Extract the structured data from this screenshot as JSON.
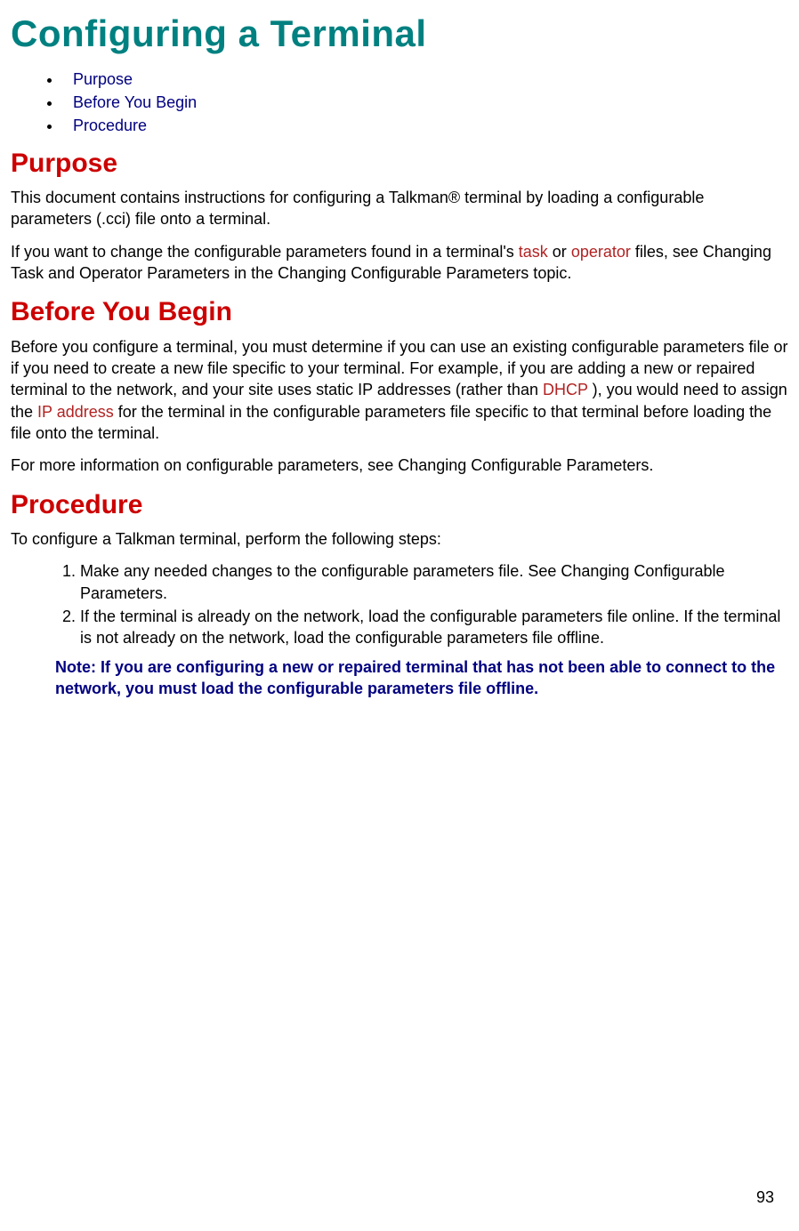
{
  "title": "Configuring a Terminal",
  "toc": {
    "items": [
      {
        "label": "Purpose"
      },
      {
        "label": "Before You Begin"
      },
      {
        "label": "Procedure"
      }
    ]
  },
  "purpose": {
    "heading": "Purpose",
    "p1": "This document contains instructions for configuring a Talkman® terminal by loading a configurable parameters (.cci) file onto a terminal.",
    "p2a": "If you want to change the configurable parameters found in a terminal's ",
    "link_task": "task",
    "p2b": " or ",
    "link_operator": "operator",
    "p2c": " files, see Changing Task and Operator Parameters in the Changing Configurable Parameters topic."
  },
  "before": {
    "heading": "Before You Begin",
    "p1a": "Before you configure a terminal, you must determine if you can use an existing configurable parameters file or if you need to create a new file specific to your terminal. For example, if you are adding a new or repaired terminal to the network, and your site uses static IP addresses (rather than ",
    "link_dhcp": "DHCP",
    "p1b": " ), you would need to assign the ",
    "link_ip": "IP address",
    "p1c": " for the terminal in the configurable parameters file specific to that terminal before loading the file onto the terminal.",
    "p2": "For more information on configurable parameters, see Changing Configurable Parameters."
  },
  "procedure": {
    "heading": "Procedure",
    "intro": "To configure a Talkman terminal, perform the following steps:",
    "steps": [
      "Make any needed changes to the configurable parameters file. See Changing Configurable Parameters.",
      "If the terminal is already on the network, load the configurable parameters file online.  If the terminal is not already on the network, load the configurable parameters file offline."
    ],
    "note": "Note: If you are configuring a new or repaired terminal that has not been able to connect to the network, you must load the configurable parameters file offline."
  },
  "page_number": "93"
}
